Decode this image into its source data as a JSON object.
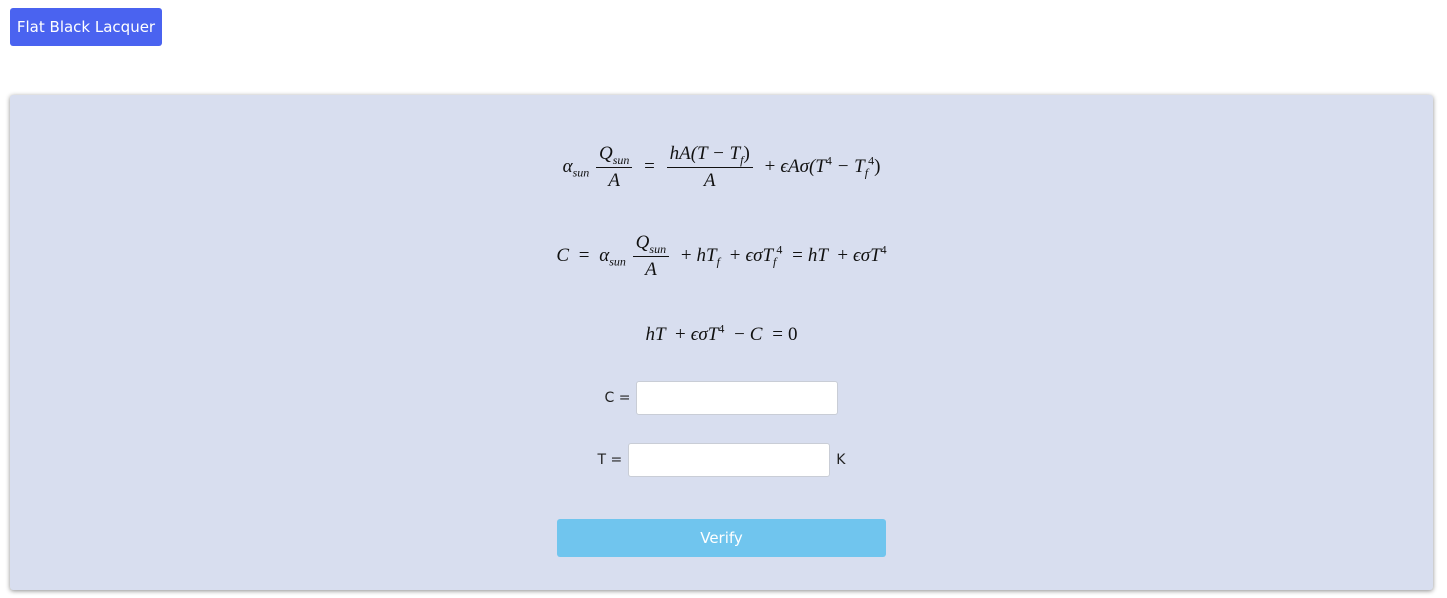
{
  "top_button": {
    "label": "Flat Black Lacquer"
  },
  "equations": {
    "eq1": {
      "alpha": "α",
      "sun": "sun",
      "Q": "Q",
      "A": "A",
      "equals": "=",
      "hA_paren": "hA(T − T",
      "f": "f",
      "close": ")",
      "plus": "+",
      "eps_A_sigma": "ϵAσ(T",
      "four": "4",
      "minus": "− T",
      "close2": ")"
    },
    "eq2": {
      "C": "C",
      "equals": "=",
      "alpha": "α",
      "sun": "sun",
      "Q": "Q",
      "A": "A",
      "plus1": "+",
      "hT": "hT",
      "f": "f",
      "plus2": "+",
      "eps_sigma": "ϵσT",
      "four": "4",
      "equals2": "=",
      "hT2": "hT",
      "plus3": "+",
      "eps_sigma2": "ϵσT"
    },
    "eq3": {
      "hT": "hT",
      "plus": "+",
      "eps_sigma": "ϵσT",
      "four": "4",
      "minus": "−",
      "C": "C",
      "equals": "=",
      "zero": "0"
    }
  },
  "fields": {
    "c": {
      "label": "C =",
      "value": ""
    },
    "t": {
      "label": "T =",
      "value": "",
      "unit": "K"
    }
  },
  "verify_button": {
    "label": "Verify"
  },
  "colors": {
    "primary": "#4a63f0",
    "panel_bg": "#d8deef",
    "verify": "#70c5ee"
  }
}
